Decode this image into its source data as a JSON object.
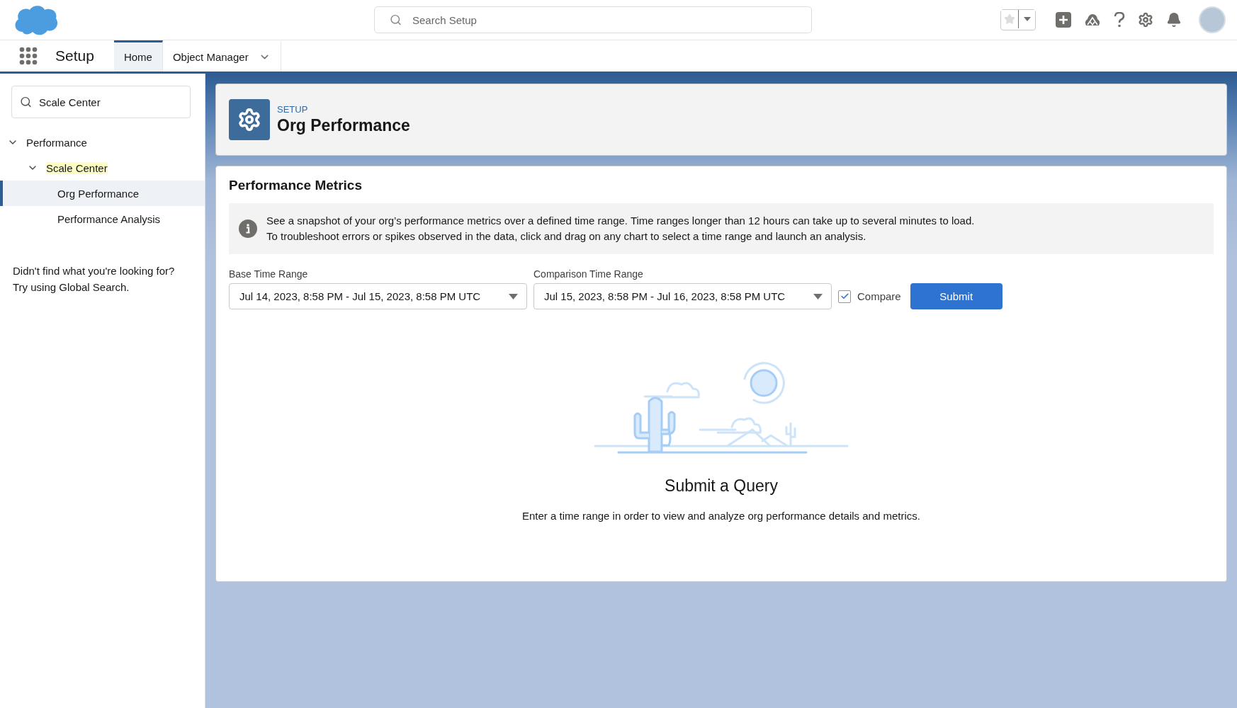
{
  "global_header": {
    "search": {
      "placeholder": "Search Setup"
    }
  },
  "app_nav": {
    "app_name": "Setup",
    "tabs": [
      {
        "label": "Home",
        "selected": true,
        "has_menu": false
      },
      {
        "label": "Object Manager",
        "selected": false,
        "has_menu": true
      }
    ]
  },
  "sidebar": {
    "search": {
      "value": "Scale Center"
    },
    "tree": [
      {
        "label": "Performance",
        "expanded": true,
        "highlighted": false,
        "selected": false,
        "children": [
          {
            "label": "Scale Center",
            "expanded": true,
            "highlighted": true,
            "selected": false,
            "children": [
              {
                "label": "Org Performance",
                "highlighted": false,
                "selected": true
              },
              {
                "label": "Performance Analysis",
                "highlighted": false,
                "selected": false
              }
            ]
          }
        ]
      }
    ],
    "help_text": [
      "Didn't find what you're looking for?",
      "Try using Global Search."
    ]
  },
  "page_header": {
    "eyebrow": "SETUP",
    "title": "Org Performance"
  },
  "card": {
    "title": "Performance Metrics",
    "info_lines": [
      "See a snapshot of your org’s performance metrics over a defined time range. Time ranges longer than 12 hours can take up to several minutes to load.",
      "To troubleshoot errors or spikes observed in the data, click and drag on any chart to select a time range and launch an analysis."
    ],
    "base_range": {
      "label": "Base Time Range",
      "value": "Jul 14, 2023, 8:58 PM - Jul 15, 2023, 8:58 PM UTC"
    },
    "comparison_range": {
      "label": "Comparison Time Range",
      "value": "Jul 15, 2023, 8:58 PM - Jul 16, 2023, 8:58 PM UTC"
    },
    "compare": {
      "label": "Compare",
      "checked": true
    },
    "submit": "Submit",
    "empty_state": {
      "title": "Submit a Query",
      "message": "Enter a time range in order to view and analyze org performance details and metrics."
    }
  }
}
